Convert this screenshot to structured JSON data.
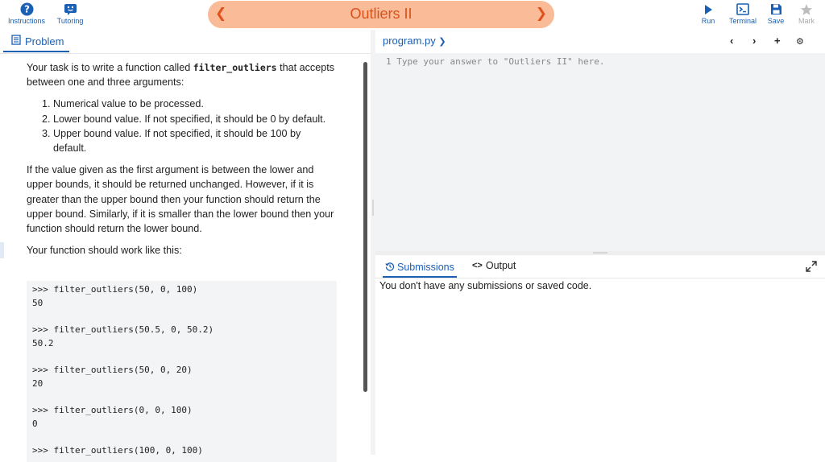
{
  "toolbar": {
    "instructions_label": "Instructions",
    "tutoring_label": "Tutoring",
    "run_label": "Run",
    "terminal_label": "Terminal",
    "save_label": "Save",
    "mark_label": "Mark"
  },
  "title": "Outliers II",
  "left": {
    "tab_label": "Problem",
    "intro_pre": "Your task is to write a function called ",
    "func_name": "filter_outliers",
    "intro_post": " that accepts between one and three arguments:",
    "items": [
      "Numerical value to be processed.",
      "Lower bound value. If not specified, it should be 0 by default.",
      "Upper bound value. If not specified, it should be 100 by default."
    ],
    "para2": "If the value given as the first argument is between the lower and upper bounds, it should be returned unchanged. However, if it is greater than the upper bound then your function should return the upper bound. Similarly, if it is smaller than the lower bound then your function should return the lower bound.",
    "para3": "Your function should work like this:",
    "examples": [
      {
        "call": ">>> filter_outliers(50, 0, 100)",
        "result": "50"
      },
      {
        "call": ">>> filter_outliers(50.5, 0, 50.2)",
        "result": "50.2"
      },
      {
        "call": ">>> filter_outliers(50, 0, 20)",
        "result": "20"
      },
      {
        "call": ">>> filter_outliers(0, 0, 100)",
        "result": "0"
      },
      {
        "call": ">>> filter_outliers(100, 0, 100)",
        "result": ""
      }
    ]
  },
  "editor": {
    "file_name": "program.py",
    "line1": "1 Type your answer to \"Outliers II\" here."
  },
  "bottom": {
    "submissions_label": "Submissions",
    "output_label": "Output",
    "empty_message": "You don't have any submissions or saved code."
  },
  "colors": {
    "accent": "#1a5fb4",
    "title_pill": "#f9bb98",
    "title_text": "#d8521c"
  }
}
